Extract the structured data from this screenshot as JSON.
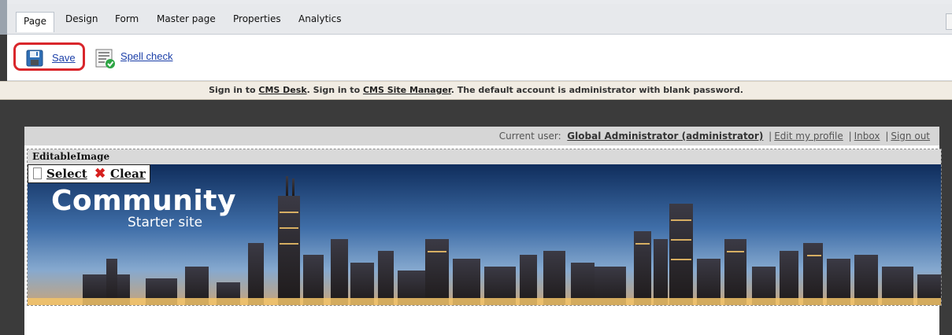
{
  "tabs": [
    {
      "label": "Page",
      "active": true
    },
    {
      "label": "Design"
    },
    {
      "label": "Form"
    },
    {
      "label": "Master page"
    },
    {
      "label": "Properties"
    },
    {
      "label": "Analytics"
    }
  ],
  "toolbar": {
    "save_label": "Save",
    "spell_label": "Spell check",
    "save_icon": "floppy-disk-icon",
    "spell_icon": "spell-check-icon",
    "highlight_color": "#d9262b"
  },
  "notice": {
    "t1": "Sign in to ",
    "link1": "CMS Desk",
    "t2": ". Sign in to ",
    "link2": "CMS Site Manager",
    "t3": ". The default account is administrator with blank password."
  },
  "userbar": {
    "prefix": "Current user:",
    "user": "Global Administrator (administrator)",
    "edit_profile": "Edit my profile",
    "inbox": "Inbox",
    "sign_out": "Sign out",
    "separator": "|"
  },
  "editable": {
    "title": "EditableImage",
    "select_label": "Select",
    "clear_label": "Clear",
    "clear_icon": "red-x-icon"
  },
  "banner": {
    "title": "Community",
    "subtitle": "Starter site"
  }
}
